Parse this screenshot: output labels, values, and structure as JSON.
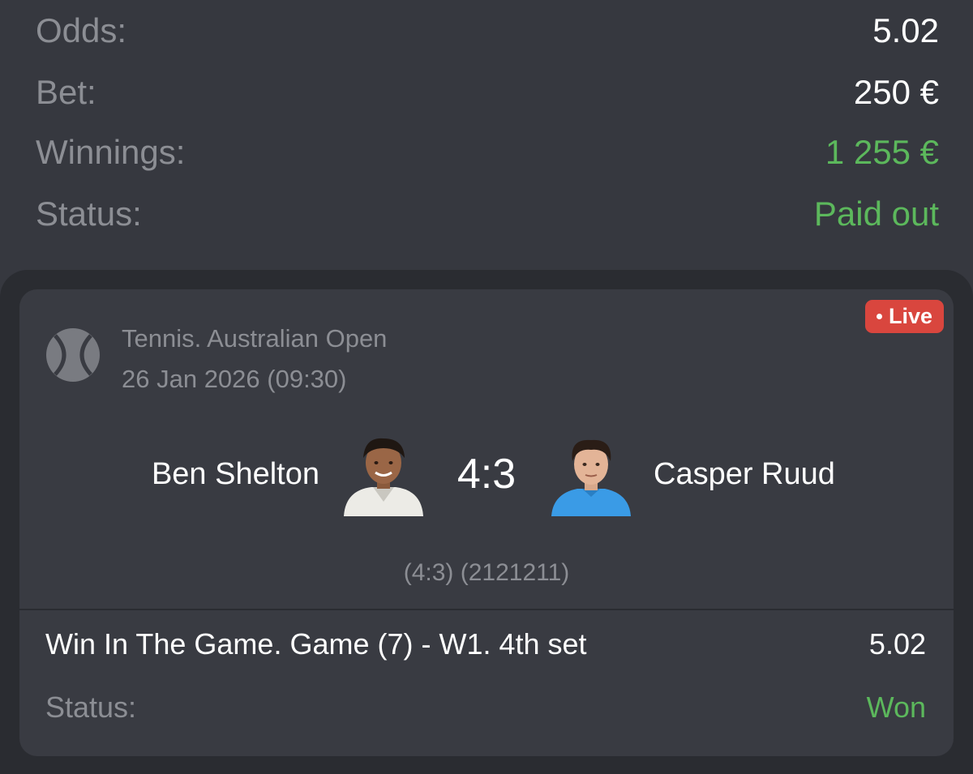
{
  "summary": {
    "odds_label": "Odds:",
    "odds_value": "5.02",
    "bet_label": "Bet:",
    "bet_value": "250 €",
    "winnings_label": "Winnings:",
    "winnings_value": "1 255 €",
    "status_label": "Status:",
    "status_value": "Paid out"
  },
  "event": {
    "sport_icon": "tennis-ball-icon",
    "tournament": "Tennis. Australian Open",
    "datetime": "26 Jan 2026 (09:30)",
    "live_label": "Live",
    "team1": {
      "name": "Ben Shelton",
      "shirt_color": "#ecebe6"
    },
    "team2": {
      "name": "Casper Ruud",
      "shirt_color": "#3a9be6"
    },
    "score": "4:3",
    "set_details": "(4:3) (2121211)"
  },
  "selection": {
    "market": "Win In The Game. Game (7) - W1. 4th set",
    "odds": "5.02",
    "status_label": "Status:",
    "status_value": "Won"
  },
  "colors": {
    "background": "#36383f",
    "card": "#393b42",
    "win_green": "#5cb85c",
    "live_red": "#d9463e",
    "muted_text": "#8c8e94"
  }
}
